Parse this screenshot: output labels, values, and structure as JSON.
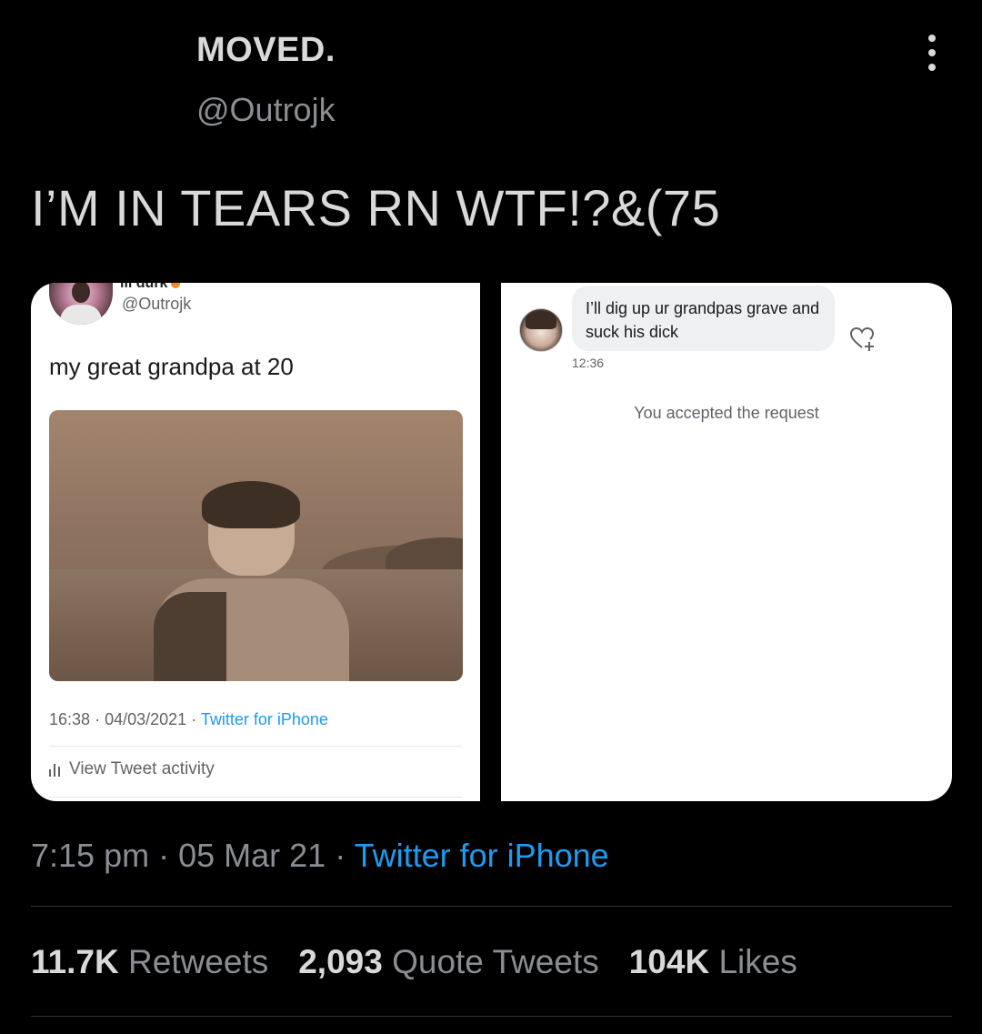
{
  "author": {
    "display_name": "MOVED.",
    "handle": "@Outrojk"
  },
  "tweet": {
    "text": "I’M IN TEARS RN WTF!?&(75",
    "time": "7:15 pm",
    "date": "05 Mar 21",
    "source": "Twitter for iPhone",
    "separator": "·"
  },
  "media": {
    "left": {
      "cut_name": "lil durk",
      "handle": "@Outrojk",
      "text": "my great grandpa at 20",
      "time": "16:38",
      "date": "04/03/2021",
      "source": "Twitter for iPhone",
      "activity": "View Tweet activity"
    },
    "right": {
      "message": "I’ll dig up ur grandpas grave and suck his dick",
      "message_time": "12:36",
      "status": "You accepted the request"
    }
  },
  "stats": {
    "retweets_count": "11.7K",
    "retweets_label": "Retweets",
    "quotes_count": "2,093",
    "quotes_label": "Quote Tweets",
    "likes_count": "104K",
    "likes_label": "Likes"
  },
  "colors": {
    "background": "#000000",
    "link": "#1d9bf0",
    "muted": "#8a8d91"
  },
  "icons": [
    "more-vertical-icon",
    "heart-plus-icon",
    "activity-bars-icon"
  ]
}
